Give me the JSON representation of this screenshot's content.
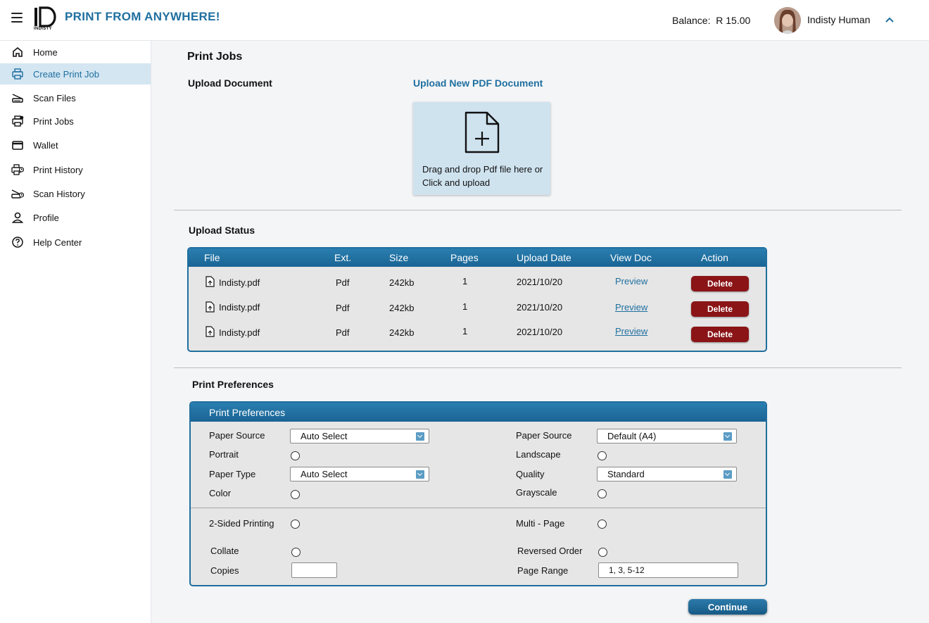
{
  "header": {
    "app_title": "PRINT FROM ANYWHERE!",
    "logo_text": "INDISTY",
    "balance_label": "Balance:",
    "balance_value": "R 15.00",
    "user_name": "Indisty Human"
  },
  "sidebar": {
    "items": [
      {
        "label": "Home",
        "icon": "home-icon"
      },
      {
        "label": "Create Print Job",
        "icon": "printer-icon",
        "active": true
      },
      {
        "label": "Scan Files",
        "icon": "scanner-icon"
      },
      {
        "label": "Print Jobs",
        "icon": "print-jobs-icon"
      },
      {
        "label": "Wallet",
        "icon": "wallet-icon"
      },
      {
        "label": "Print History",
        "icon": "print-history-icon"
      },
      {
        "label": "Scan History",
        "icon": "scan-history-icon"
      },
      {
        "label": "Profile",
        "icon": "user-icon"
      },
      {
        "label": "Help Center",
        "icon": "help-icon"
      }
    ]
  },
  "main": {
    "page_title": "Print Jobs",
    "upload": {
      "section_title": "Upload Document",
      "link": "Upload New PDF Document",
      "drop_text": "Drag and drop Pdf file here or Click and upload"
    },
    "status": {
      "section_title": "Upload Status",
      "columns": [
        "File",
        "Ext.",
        "Size",
        "Pages",
        "Upload Date",
        "View Doc",
        "Action"
      ],
      "rows": [
        {
          "file": "Indisty.pdf",
          "ext": "Pdf",
          "size": "242kb",
          "pages": "1",
          "date": "2021/10/20",
          "view": "Preview",
          "action": "Delete"
        },
        {
          "file": "Indisty.pdf",
          "ext": "Pdf",
          "size": "242kb",
          "pages": "1",
          "date": "2021/10/20",
          "view": "Preview",
          "action": "Delete"
        },
        {
          "file": "Indisty.pdf",
          "ext": "Pdf",
          "size": "242kb",
          "pages": "1",
          "date": "2021/10/20",
          "view": "Preview",
          "action": "Delete"
        }
      ]
    },
    "prefs": {
      "section_title": "Print Preferences",
      "panel_title": "Print Preferences",
      "paper_source_label": "Paper Source",
      "paper_source_value": "Auto Select",
      "portrait_label": "Portrait",
      "paper_type_label": "Paper Type",
      "paper_type_value": "Auto Select",
      "color_label": "Color",
      "paper_source2_label": "Paper Source",
      "paper_source2_value": "Default (A4)",
      "landscape_label": "Landscape",
      "quality_label": "Quality",
      "quality_value": "Standard",
      "grayscale_label": "Grayscale",
      "two_sided_label": "2-Sided Printing",
      "collate_label": "Collate",
      "copies_label": "Copies",
      "copies_value": "",
      "multi_page_label": "Multi - Page",
      "reversed_label": "Reversed Order",
      "page_range_label": "Page Range",
      "page_range_value": "1, 3, 5-12"
    },
    "continue_label": "Continue"
  },
  "colors": {
    "brand": "#1f6f9f",
    "active_nav": "#d4e6f2",
    "delete": "#8a1416",
    "dropzone": "#cfe3ef"
  }
}
